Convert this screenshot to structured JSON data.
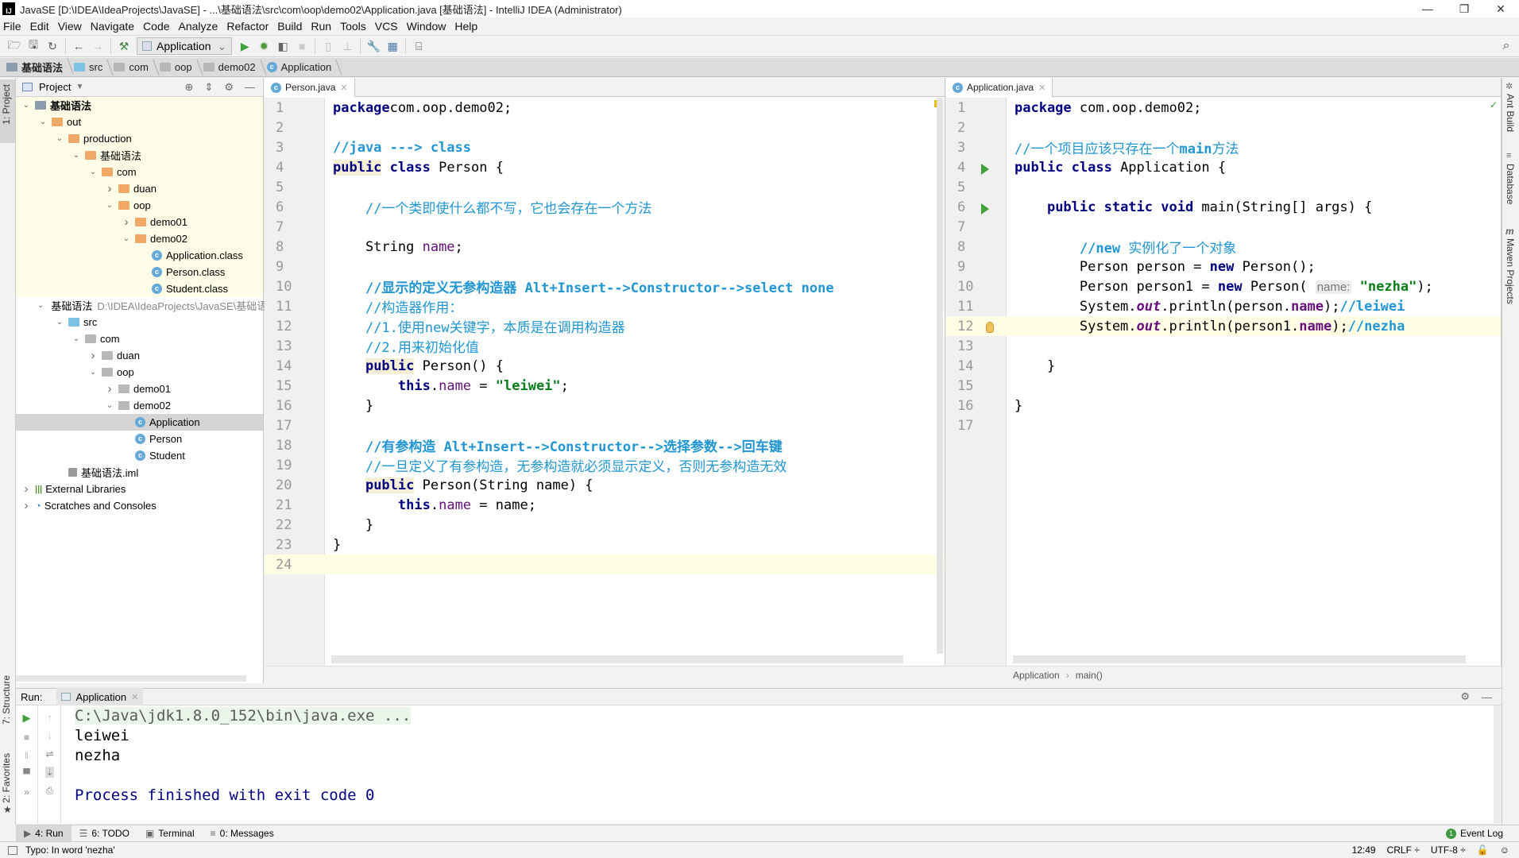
{
  "window": {
    "title": "JavaSE [D:\\IDEA\\IdeaProjects\\JavaSE] - ...\\基础语法\\src\\com\\oop\\demo02\\Application.java [基础语法] - IntelliJ IDEA (Administrator)",
    "app_icon": "IJ",
    "minimize": "—",
    "maximize": "❐",
    "close": "✕"
  },
  "menu": [
    "File",
    "Edit",
    "View",
    "Navigate",
    "Code",
    "Analyze",
    "Refactor",
    "Build",
    "Run",
    "Tools",
    "VCS",
    "Window",
    "Help"
  ],
  "toolbar": {
    "run_config": "Application",
    "run_config_arrow": "⌄"
  },
  "breadcrumb": [
    "基础语法",
    "src",
    "com",
    "oop",
    "demo02",
    "Application"
  ],
  "left_strip": {
    "project_tab": "1: Project",
    "structure_tab": "7: Structure",
    "favorites_tab": "2: Favorites"
  },
  "right_strip": {
    "ant": "Ant Build",
    "database": "Database",
    "maven": "Maven Projects"
  },
  "project": {
    "title": "Project",
    "tree": [
      {
        "label": "基础语法",
        "depth": 0,
        "icon": "module",
        "chev": "v",
        "bg": "y"
      },
      {
        "label": "out",
        "depth": 1,
        "icon": "folder-orange",
        "chev": "v",
        "bg": "y"
      },
      {
        "label": "production",
        "depth": 2,
        "icon": "folder-orange",
        "chev": "v",
        "bg": "y"
      },
      {
        "label": "基础语法",
        "depth": 3,
        "icon": "folder-orange",
        "chev": "v",
        "bg": "y"
      },
      {
        "label": "com",
        "depth": 4,
        "icon": "folder-orange",
        "chev": "v",
        "bg": "y"
      },
      {
        "label": "duan",
        "depth": 5,
        "icon": "folder-orange",
        "chev": ">",
        "bg": "y"
      },
      {
        "label": "oop",
        "depth": 5,
        "icon": "folder-orange",
        "chev": "v",
        "bg": "y"
      },
      {
        "label": "demo01",
        "depth": 6,
        "icon": "folder-orange",
        "chev": ">",
        "bg": "y"
      },
      {
        "label": "demo02",
        "depth": 6,
        "icon": "folder-orange",
        "chev": "v",
        "bg": "y"
      },
      {
        "label": "Application.class",
        "depth": 7,
        "icon": "class",
        "chev": "",
        "bg": "y"
      },
      {
        "label": "Person.class",
        "depth": 7,
        "icon": "class",
        "chev": "",
        "bg": "y"
      },
      {
        "label": "Student.class",
        "depth": 7,
        "icon": "class",
        "chev": "",
        "bg": "y"
      },
      {
        "label": "基础语法",
        "depth": 1,
        "icon": "module",
        "chev": "v",
        "bg": "",
        "path": "D:\\IDEA\\IdeaProjects\\JavaSE\\基础语"
      },
      {
        "label": "src",
        "depth": 2,
        "icon": "folder-blue",
        "chev": "v",
        "bg": ""
      },
      {
        "label": "com",
        "depth": 3,
        "icon": "folder-gray",
        "chev": "v",
        "bg": ""
      },
      {
        "label": "duan",
        "depth": 4,
        "icon": "folder-gray",
        "chev": ">",
        "bg": ""
      },
      {
        "label": "oop",
        "depth": 4,
        "icon": "folder-gray",
        "chev": "v",
        "bg": ""
      },
      {
        "label": "demo01",
        "depth": 5,
        "icon": "folder-gray",
        "chev": ">",
        "bg": ""
      },
      {
        "label": "demo02",
        "depth": 5,
        "icon": "folder-gray",
        "chev": "v",
        "bg": ""
      },
      {
        "label": "Application",
        "depth": 6,
        "icon": "class",
        "chev": "",
        "bg": "sel"
      },
      {
        "label": "Person",
        "depth": 6,
        "icon": "class",
        "chev": "",
        "bg": ""
      },
      {
        "label": "Student",
        "depth": 6,
        "icon": "class",
        "chev": "",
        "bg": ""
      },
      {
        "label": "基础语法.iml",
        "depth": 2,
        "icon": "iml",
        "chev": "",
        "bg": ""
      },
      {
        "label": "External Libraries",
        "depth": 0,
        "icon": "libs",
        "chev": ">",
        "bg": ""
      },
      {
        "label": "Scratches and Consoles",
        "depth": 0,
        "icon": "scratch",
        "chev": ">",
        "bg": ""
      }
    ]
  },
  "editor_left": {
    "tab": "Person.java",
    "current_line": 24,
    "lines": [
      [
        [
          "kw",
          "package"
        ],
        [
          "",
          "com.oop.demo02;"
        ]
      ],
      [],
      [
        [
          "cmb",
          "//java ---> class"
        ]
      ],
      [
        [
          "kw pubhl",
          "public"
        ],
        [
          "",
          ""
        ],
        [
          "kw",
          " class"
        ],
        [
          "",
          " Person {"
        ]
      ],
      [],
      [
        [
          "",
          "    "
        ],
        [
          "cm",
          "//一个类即使什么都不写，它也会存在一个方法"
        ]
      ],
      [],
      [
        [
          "",
          "    String "
        ],
        [
          "fld",
          "name"
        ],
        [
          "",
          ";"
        ]
      ],
      [],
      [
        [
          "",
          "    "
        ],
        [
          "cmb",
          "//显示的定义无参构造器 Alt+Insert-->Constructor-->select none"
        ]
      ],
      [
        [
          "",
          "    "
        ],
        [
          "cm",
          "//构造器作用："
        ]
      ],
      [
        [
          "",
          "    "
        ],
        [
          "cm",
          "//1.使用new关键字，本质是在调用构造器"
        ]
      ],
      [
        [
          "",
          "    "
        ],
        [
          "cm",
          "//2.用来初始化值"
        ]
      ],
      [
        [
          "",
          "    "
        ],
        [
          "kw pubhl",
          "public"
        ],
        [
          "",
          " Person() {"
        ]
      ],
      [
        [
          "",
          "        "
        ],
        [
          "kw",
          "this"
        ],
        [
          "",
          "."
        ],
        [
          "fld",
          "name"
        ],
        [
          "",
          " = "
        ],
        [
          "str",
          "\"leiwei\""
        ],
        [
          "",
          ";"
        ]
      ],
      [
        [
          "",
          "    }"
        ]
      ],
      [],
      [
        [
          "",
          "    "
        ],
        [
          "cmb",
          "//有参构造 Alt+Insert-->Constructor-->选择参数-->回车键"
        ]
      ],
      [
        [
          "",
          "    "
        ],
        [
          "cm",
          "//一旦定义了有参构造，无参构造就必须显示定义，否则无参构造无效"
        ]
      ],
      [
        [
          "",
          "    "
        ],
        [
          "kw pubhl",
          "public"
        ],
        [
          "",
          " Person(String name) {"
        ]
      ],
      [
        [
          "",
          "        "
        ],
        [
          "kw",
          "this"
        ],
        [
          "",
          "."
        ],
        [
          "fld",
          "name"
        ],
        [
          "",
          " = name;"
        ]
      ],
      [
        [
          "",
          "    }"
        ]
      ],
      [
        [
          "",
          "}"
        ]
      ],
      []
    ]
  },
  "editor_right": {
    "tab": "Application.java",
    "current_line": 12,
    "run_lines": [
      4,
      6
    ],
    "bulb_line": 12,
    "lines": [
      [
        [
          "kw",
          "package"
        ],
        [
          "",
          " com.oop.demo02;"
        ]
      ],
      [],
      [
        [
          "cm",
          "//一个项目应该只存在一个"
        ],
        [
          "cmb",
          "main"
        ],
        [
          "cm",
          "方法"
        ]
      ],
      [
        [
          "kw",
          "public class"
        ],
        [
          "",
          " Application {"
        ]
      ],
      [],
      [
        [
          "",
          "    "
        ],
        [
          "kw",
          "public static void"
        ],
        [
          "",
          " main(String[] args) {"
        ]
      ],
      [],
      [
        [
          "",
          "        "
        ],
        [
          "cmb",
          "//new "
        ],
        [
          "cm",
          "实例化了一个对象"
        ]
      ],
      [
        [
          "",
          "        Person person = "
        ],
        [
          "kw",
          "new"
        ],
        [
          "",
          " Person();"
        ]
      ],
      [
        [
          "",
          "        Person person1 = "
        ],
        [
          "kw",
          "new"
        ],
        [
          "",
          " Person( "
        ],
        [
          "hint",
          "name:"
        ],
        [
          "",
          ""
        ],
        [
          "str",
          " \"nezha\""
        ],
        [
          "",
          ");"
        ]
      ],
      [
        [
          "",
          "        System."
        ],
        [
          "it",
          "out"
        ],
        [
          "",
          ".println(person."
        ],
        [
          "fldb",
          "name"
        ],
        [
          "",
          ");"
        ],
        [
          "cmb",
          "//leiwei"
        ]
      ],
      [
        [
          "",
          "        System."
        ],
        [
          "it",
          "out"
        ],
        [
          "",
          ".println(person1."
        ],
        [
          "fldb",
          "name"
        ],
        [
          "",
          ");"
        ],
        [
          "cmb",
          "//nezha"
        ]
      ],
      [],
      [
        [
          "",
          "    }"
        ]
      ],
      [],
      [
        [
          "",
          "}"
        ]
      ],
      []
    ]
  },
  "editor_breadcrumb": [
    "Application",
    "main()"
  ],
  "run_panel": {
    "label": "Run:",
    "tab": "Application",
    "output": [
      {
        "text": "C:\\Java\\jdk1.8.0_152\\bin\\java.exe ...",
        "style": "cmd"
      },
      {
        "text": "leiwei",
        "style": "out"
      },
      {
        "text": "nezha",
        "style": "out"
      },
      {
        "text": "",
        "style": "out"
      },
      {
        "text": "Process finished with exit code 0",
        "style": "exit"
      }
    ]
  },
  "bottom_tabs": [
    {
      "label": "4: Run",
      "icon": "▶",
      "active": true
    },
    {
      "label": "6: TODO",
      "icon": "☰",
      "active": false
    },
    {
      "label": "Terminal",
      "icon": "▣",
      "active": false
    },
    {
      "label": "0: Messages",
      "icon": "≡",
      "active": false
    }
  ],
  "event_log": {
    "label": "Event Log",
    "count": "1"
  },
  "status": {
    "message": "Typo: In word 'nezha'",
    "position": "12:49",
    "line_sep": "CRLF ÷",
    "encoding": "UTF-8 ÷"
  },
  "colors": {
    "keyword": "#000080",
    "comment": "#2196d3",
    "string": "#067d17",
    "field": "#660e7a",
    "current_line": "#fffde4",
    "selection": "#d5d5d5",
    "run_green": "#3fa33a"
  }
}
